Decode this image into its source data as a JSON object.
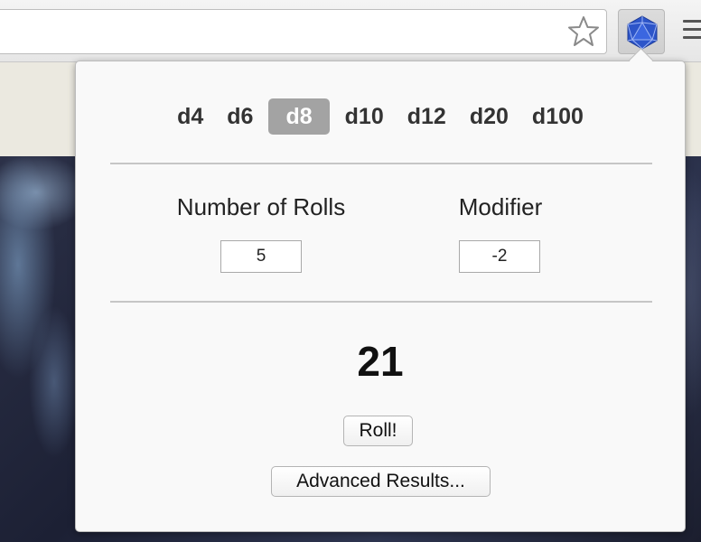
{
  "browser": {
    "bookmark_icon": "star-outline-icon",
    "extension_icon": "d20-icosahedron-icon",
    "menu_icon": "hamburger-menu-icon",
    "extension_color": "#2d55c9"
  },
  "popup": {
    "dice": [
      {
        "label": "d4",
        "selected": false
      },
      {
        "label": "d6",
        "selected": false
      },
      {
        "label": "d8",
        "selected": true
      },
      {
        "label": "d10",
        "selected": false
      },
      {
        "label": "d12",
        "selected": false
      },
      {
        "label": "d20",
        "selected": false
      },
      {
        "label": "d100",
        "selected": false
      }
    ],
    "rolls_label": "Number of Rolls",
    "rolls_value": "5",
    "modifier_label": "Modifier",
    "modifier_value": "-2",
    "result": "21",
    "roll_button": "Roll!",
    "advanced_button": "Advanced Results..."
  }
}
